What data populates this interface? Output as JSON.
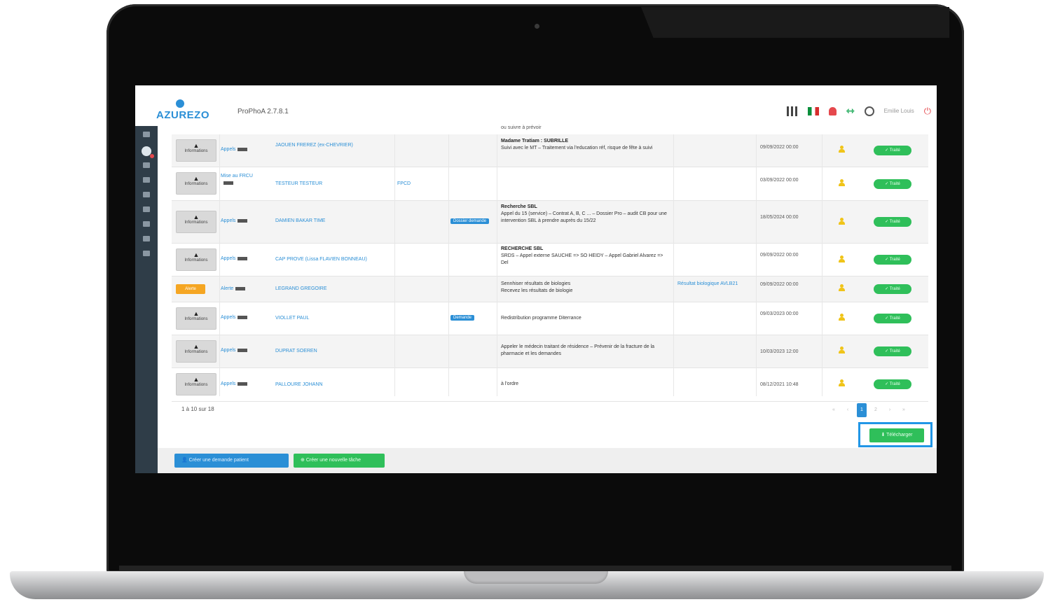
{
  "app": {
    "logo_text": "AZUREZO",
    "version": "ProPhoA 2.7.8.1",
    "user_name": "Emilie Louis"
  },
  "top_icons": [
    "apps-grid-icon",
    "flag-icon",
    "bell-icon",
    "connection-icon",
    "user-icon",
    "logout-icon"
  ],
  "table": {
    "top_fragment": "ou suivre à prévoir",
    "rows": [
      {
        "action": "Informations",
        "type": "Appels",
        "name": "JAOUEN FREREZ (ex-CHEVRIER)",
        "extra": "",
        "tag": "",
        "desc_title": "Madame Tratiam : SUBRILLE",
        "desc": "Suivi avec le MT – Traitement via l'education réf, risque de fête à suivi",
        "link": "",
        "date": "09/09/2022 00:00",
        "status": "✓ Traité"
      },
      {
        "action": "Informations",
        "type": "Mise au FRCU",
        "name": "TESTEUR TESTEUR",
        "extra": "FPCD",
        "tag": "",
        "desc_title": "",
        "desc": "",
        "link": "",
        "date": "03/09/2022 00:00",
        "status": "✓ Traité"
      },
      {
        "action": "Informations",
        "type": "Appels",
        "name": "DAMIEN BAKAR TIME",
        "extra": "",
        "tag": "Dossier demande",
        "desc_title": "Recherche SBL",
        "desc": "Appel du 15 (service) – Contrat A, B, C ... – Dossier Pro – audit CB pour une intervention SBL à prendre auprès du 15/22",
        "link": "",
        "date": "18/05/2024 00:00",
        "status": "✓ Traité"
      },
      {
        "action": "Informations",
        "type": "Appels",
        "name": "CAP PROVE (Lissa FLAVIEN BONNEAU)",
        "extra": "",
        "tag": "",
        "desc_title": "RECHERCHE SBL",
        "desc": "SRDS – Appel externe SAUCHE => SO HEIDY – Appel Gabriel Alvarez => Del",
        "link": "",
        "date": "09/09/2022 00:00",
        "status": "✓ Traité"
      },
      {
        "action": "Alerte",
        "type": "Alerte",
        "name": "LEGRAND GREGOIRE",
        "extra": "",
        "tag": "",
        "desc_title": "Sennhiser résultats de biologies",
        "desc": "Recevez les résultats de biologie",
        "link": "Résultat biologique AVLB21",
        "date": "09/09/2022 00:00",
        "status": "✓ Traité"
      },
      {
        "action": "Informations",
        "type": "Appels",
        "name": "VIOLLET PAUL",
        "extra": "",
        "tag": "Demande",
        "desc_title": "",
        "desc": "Redistribution programme Diterrance",
        "link": "",
        "date": "09/03/2023 00:00",
        "status": "✓ Traité"
      },
      {
        "action": "Informations",
        "type": "Appels",
        "name": "DUPRAT SOEREN",
        "extra": "",
        "tag": "",
        "desc_title": "",
        "desc": "Appeler le médecin traitant de résidence – Prévenir de la fracture de la pharmacie et les demandes",
        "link": "",
        "date": "10/03/2023 12:00",
        "status": "✓ Traité"
      },
      {
        "action": "Informations",
        "type": "Appels",
        "name": "PALLOURE JOHANN",
        "extra": "",
        "tag": "",
        "desc_title": "",
        "desc": "à l'ordre",
        "link": "",
        "date": "08/12/2021 10:48",
        "status": "✓ Traité"
      }
    ]
  },
  "pagination": {
    "count_text": "1 à 10 sur 18",
    "pages": [
      "«",
      "‹",
      "1",
      "2",
      "›",
      "»"
    ],
    "active_page": "1"
  },
  "buttons": {
    "export": "Télécharger",
    "footer_blue": "Créer une demande patient",
    "footer_green": "Créer une nouvelle tâche"
  }
}
